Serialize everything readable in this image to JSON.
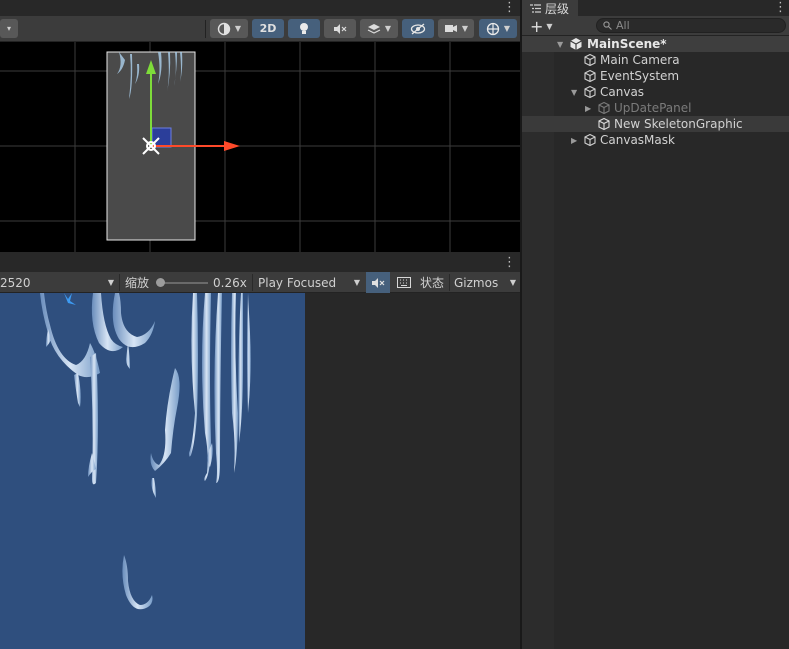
{
  "scene_view": {
    "toolbar": {
      "mode_2d_label": "2D",
      "tool_dropdown_arrow": "▾"
    },
    "canvas": {
      "background": "#000000",
      "grid_color": "#4a4a4a",
      "rect_color": "#ffffff",
      "x_axis_color": "#ff4a2a",
      "y_axis_color": "#7edc3a"
    }
  },
  "game_view": {
    "toolbar": {
      "resolution_value": "2520",
      "scale_label": "缩放",
      "scale_value": "0.26x",
      "play_mode_value": "Play Focused",
      "stats_label": "状态",
      "gizmos_label": "Gizmos"
    },
    "canvas_background": "#2f4f7e"
  },
  "hierarchy": {
    "tab_label": "层级",
    "search_placeholder": "All",
    "add_button_label": "+",
    "items": [
      {
        "label": "MainScene*",
        "depth": 0,
        "expanded": true,
        "type": "scene"
      },
      {
        "label": "Main Camera",
        "depth": 1,
        "type": "gameobject"
      },
      {
        "label": "EventSystem",
        "depth": 1,
        "type": "gameobject"
      },
      {
        "label": "Canvas",
        "depth": 1,
        "expanded": true,
        "type": "gameobject"
      },
      {
        "label": "UpDatePanel",
        "depth": 2,
        "collapsed": true,
        "disabled": true,
        "type": "gameobject"
      },
      {
        "label": "New SkeletonGraphic",
        "depth": 2,
        "selected": true,
        "type": "gameobject"
      },
      {
        "label": "CanvasMask",
        "depth": 1,
        "collapsed": true,
        "type": "gameobject"
      }
    ]
  },
  "colors": {
    "panel_bg": "#282828",
    "toolbar_bg": "#3c3c3c",
    "active_button": "#46607c",
    "game_bg": "#2f4f7e"
  }
}
